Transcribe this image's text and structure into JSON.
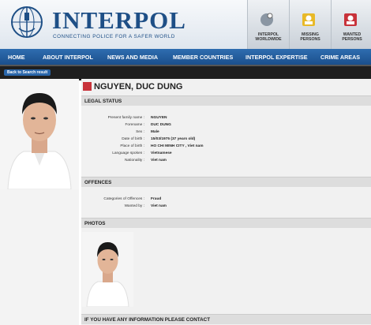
{
  "header": {
    "title": "INTERPOL",
    "tagline": "CONNECTING POLICE FOR A SAFER WORLD",
    "quick_links": [
      {
        "label": "INTERPOL\nWORLDWIDE",
        "icon": "globe-icon"
      },
      {
        "label": "MISSING\nPERSONS",
        "icon": "missing-persons-icon"
      },
      {
        "label": "WANTED\nPERSONS",
        "icon": "wanted-persons-icon"
      }
    ]
  },
  "nav": [
    "HOME",
    "ABOUT INTERPOL",
    "NEWS AND MEDIA",
    "MEMBER COUNTRIES",
    "INTERPOL EXPERTISE",
    "CRIME AREAS"
  ],
  "back_label": "Back to Search result",
  "person": {
    "name": "NGUYEN, DUC DUNG"
  },
  "legal_status": {
    "heading": "LEGAL STATUS",
    "rows": [
      {
        "label": "Present family name :",
        "value": "NGUYEN"
      },
      {
        "label": "Forename :",
        "value": "DUC DUNG"
      },
      {
        "label": "Sex :",
        "value": "Male"
      },
      {
        "label": "Date of birth :",
        "value": "15/03/1975 (37 years old)"
      },
      {
        "label": "Place of birth :",
        "value": "HO CHI MINH CITY , Viet nam"
      },
      {
        "label": "Language spoken :",
        "value": "Vietnamese"
      },
      {
        "label": "Nationality :",
        "value": "Viet nam"
      }
    ]
  },
  "offences": {
    "heading": "OFFENCES",
    "rows": [
      {
        "label": "Categories of Offences :",
        "value": "Fraud"
      },
      {
        "label": "Wanted by :",
        "value": "Viet nam"
      }
    ]
  },
  "photos_heading": "PHOTOS",
  "info_heading": "IF YOU HAVE ANY INFORMATION PLEASE CONTACT"
}
